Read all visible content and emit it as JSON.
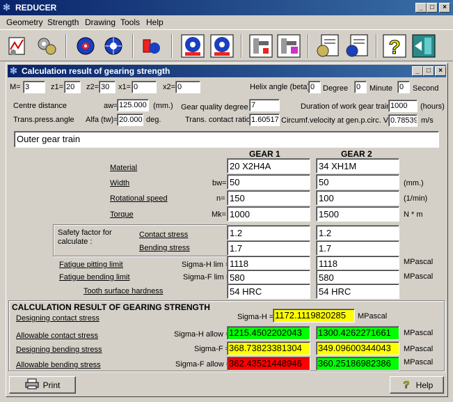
{
  "app": {
    "title": "REDUCER"
  },
  "menu": [
    "Geometry",
    "Strength",
    "Drawing",
    "Tools",
    "Help"
  ],
  "toolbar": [
    "chart-tool-icon",
    "gears-tool-icon",
    "gear-red-icon",
    "gear-blue-icon",
    "gear-pair-icon",
    "gear-front-icon",
    "gear-side-icon",
    "shaft-red-icon",
    "shaft-purple-icon",
    "report-gear-icon",
    "report-gear2-icon",
    "help-icon",
    "exit-icon"
  ],
  "child": {
    "title": "Calculation result of gearing strength",
    "params": {
      "m_label": "M=",
      "m": "3",
      "z1_label": "z1=",
      "z1": "20",
      "z2_label": "z2=",
      "z2": "30",
      "x1_label": "x1=",
      "x1": "0",
      "x2_label": "x2=",
      "x2": "0",
      "helix_label": "Helix angle (beta)",
      "helix_deg": "0",
      "degree_label": "Degree",
      "helix_min": "0",
      "minute_label": "Minute",
      "helix_sec": "0",
      "second_label": "Second",
      "centre_label": "Centre distance",
      "aw_label": "aw=",
      "aw": "125.000",
      "aw_unit": "(mm.)",
      "quality_label": "Gear quality degree",
      "quality": "7",
      "duration_label": "Duration of work gear train",
      "duration": "1000",
      "duration_unit": "(hours)",
      "trans_label": "Trans.press.angle",
      "alfa_label": "Alfa (tw)=",
      "alfa": "20.000",
      "alfa_unit": "deg.",
      "contact_ratio_label": "Trans. contact ratio",
      "contact_ratio": "1.60517",
      "velocity_label": "Circumf.velocity at gen.p.circ. V=",
      "velocity": "0.78539",
      "velocity_unit": "m/s"
    },
    "train_name": "Outer gear train",
    "gear1_header": "GEAR 1",
    "gear2_header": "GEAR 2",
    "rows": {
      "material": {
        "label": "Material",
        "sym": "",
        "g1": "20 X2H4A",
        "g2": "34 XH1M",
        "unit": ""
      },
      "width": {
        "label": "Width",
        "sym": "bw=",
        "g1": "50",
        "g2": "50",
        "unit": "(mm.)"
      },
      "speed": {
        "label": "Rotational speed",
        "sym": "n=",
        "g1": "150",
        "g2": "100",
        "unit": "(1/min)"
      },
      "torque": {
        "label": "Torque",
        "sym": "Mk=",
        "g1": "1000",
        "g2": "1500",
        "unit": "N * m"
      }
    },
    "safety": {
      "title": "Safety factor for calculate :",
      "contact_label": "Contact stress",
      "contact_g1": "1.2",
      "contact_g2": "1.2",
      "bending_label": "Bending stress",
      "bending_g1": "1.7",
      "bending_g2": "1.7"
    },
    "fatigue": {
      "pitting_label": "Fatigue pitting limit",
      "pitting_sym": "Sigma-H lim =",
      "pitting_g1": "1118",
      "pitting_g2": "1118",
      "pitting_unit": "MPascal",
      "bending_label": "Fatigue bending limit",
      "bending_sym": "Sigma-F lim =",
      "bending_g1": "580",
      "bending_g2": "580",
      "bending_unit": "MPascal",
      "hardness_label": "Tooth surface hardness",
      "hardness_g1": "54 HRC",
      "hardness_g2": "54 HRC"
    },
    "result": {
      "title": "CALCULATION RESULT OF GEARING STRENGTH",
      "dcs_label": "Designing contact stress",
      "dcs_sym": "Sigma-H =",
      "dcs": "1172.1119820285",
      "dcs_unit": "MPascal",
      "acs_label": "Allowable contact stress",
      "acs_sym": "Sigma-H allow =",
      "acs_g1": "1215.4502202043",
      "acs_g2": "1300.4262271661",
      "acs_unit": "MPascal",
      "dbs_label": "Designing bending stress",
      "dbs_sym": "Sigma-F =",
      "dbs_g1": "368.73823381304",
      "dbs_g2": "349.09600344043",
      "dbs_unit": "MPascal",
      "abs_label": "Allowable bending stress",
      "abs_sym": "Sigma-F allow =",
      "abs_g1": "362.43521448946",
      "abs_g2": "360.25186982386",
      "abs_unit": "MPascal"
    },
    "print_label": "Print",
    "help_label": "Help"
  },
  "colors": {
    "yellow": "#ffff00",
    "green": "#00ff00",
    "red": "#ff0000",
    "title_blue": "#0a246a"
  }
}
